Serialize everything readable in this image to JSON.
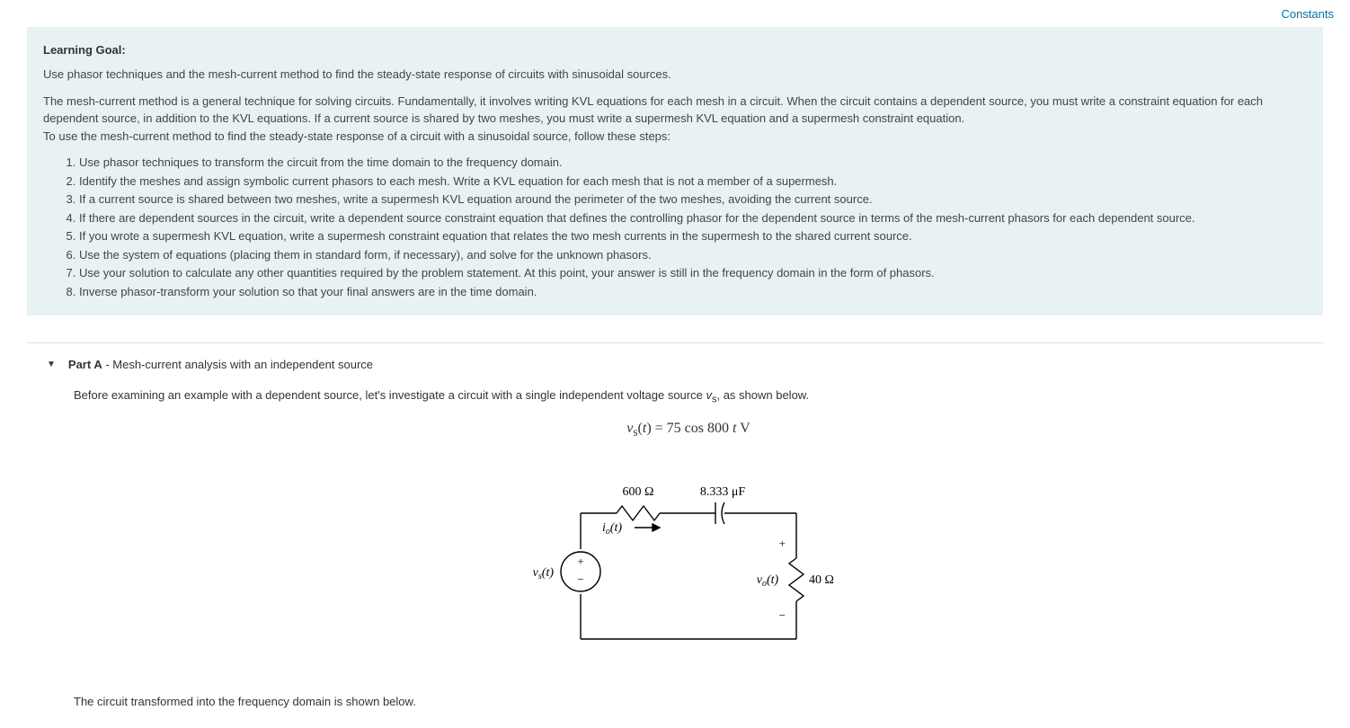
{
  "header": {
    "constants_label": "Constants"
  },
  "learning_goal": {
    "heading": "Learning Goal:",
    "intro": "Use phasor techniques and the mesh-current method to find the steady-state response of circuits with sinusoidal sources.",
    "description": "The mesh-current method is a general technique for solving circuits. Fundamentally, it involves writing KVL equations for each mesh in a circuit. When the circuit contains a dependent source, you must write a constraint equation for each dependent source, in addition to the KVL equations. If a current source is shared by two meshes, you must write a supermesh KVL equation and a supermesh constraint equation.",
    "description2": "To use the mesh-current method to find the steady-state response of a circuit with a sinusoidal source, follow these steps:",
    "steps": [
      "Use phasor techniques to transform the circuit from the time domain to the frequency domain.",
      "Identify the meshes and assign symbolic current phasors to each mesh. Write a KVL equation for each mesh that is not a member of a supermesh.",
      "If a current source is shared between two meshes, write a supermesh KVL equation around the perimeter of the two meshes, avoiding the current source.",
      "If there are dependent sources in the circuit, write a dependent source constraint equation that defines the controlling phasor for the dependent source in terms of the mesh-current phasors for each dependent source.",
      "If you wrote a supermesh KVL equation, write a supermesh constraint equation that relates the two mesh currents in the supermesh to the shared current source.",
      "Use the system of equations (placing them in standard form, if necessary), and solve for the unknown phasors.",
      "Use your solution to calculate any other quantities required by the problem statement. At this point, your answer is still in the frequency domain in the form of phasors.",
      "Inverse phasor-transform your solution so that your final answers are in the time domain."
    ]
  },
  "part_a": {
    "label": "Part A",
    "subtitle": " - Mesh-current analysis with an independent source",
    "intro_before": "Before examining an example with a dependent source, let's investigate a circuit with a single independent voltage source ",
    "intro_var": "v",
    "intro_sub": "s",
    "intro_after": ", as shown below.",
    "equation": "vₛ(t) = 75 cos 800 t V",
    "circuit": {
      "resistor_label": "600 Ω",
      "capacitor_label": "8.333 μF",
      "current_label": "iₒ(t)",
      "vs_label": "vₛ(t)",
      "vo_label": "vₒ(t)",
      "load_label": "40 Ω",
      "plus": "+",
      "minus": "−"
    },
    "footer": "The circuit transformed into the frequency domain is shown below."
  }
}
